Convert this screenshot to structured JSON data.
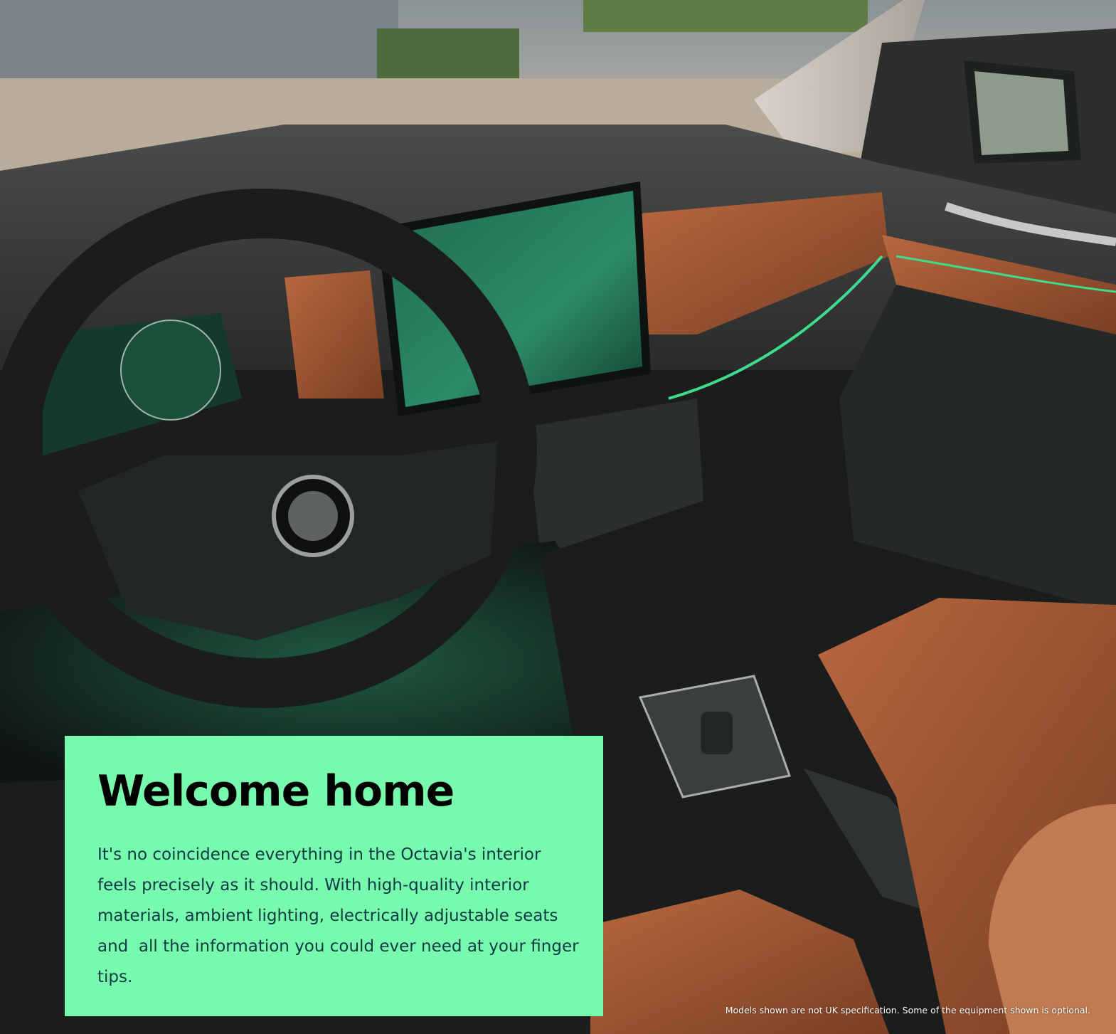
{
  "card": {
    "title": "Welcome home",
    "body": "It's no coincidence everything in the Octavia's interior feels precisely as it should. With high-quality interior materials, ambient lighting, electrically adjustable seats and  all the information you could ever need at your finger tips.",
    "background": "#78faae"
  },
  "disclaimer": "Models shown are not UK specification. Some of the equipment shown is optional.",
  "colors": {
    "leather": "#9a5331",
    "ambient_green": "#3fdc8e",
    "dashboard": "#2f3332"
  }
}
